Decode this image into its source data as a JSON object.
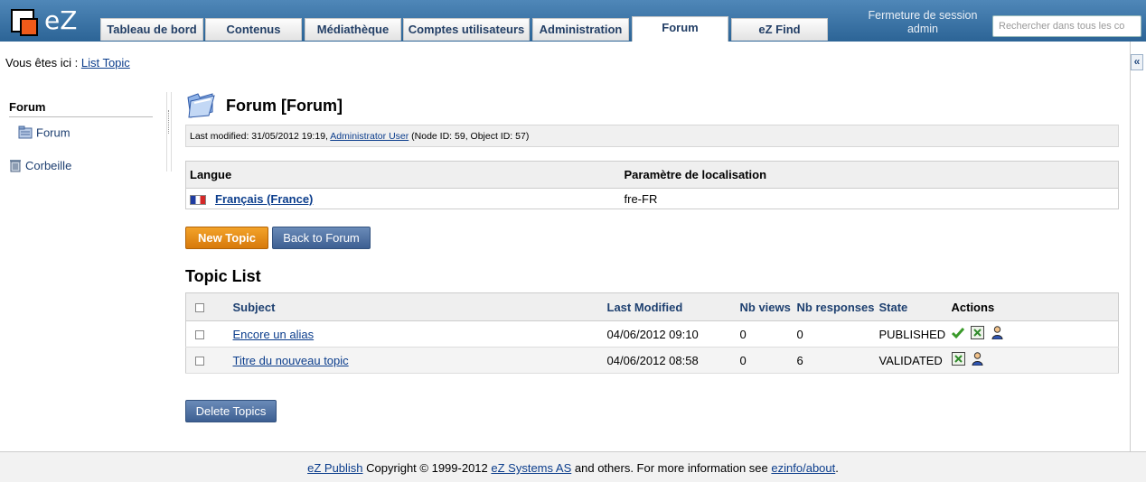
{
  "header": {
    "logo_text": "eZ",
    "tabs": [
      {
        "label": "Tableau de bord"
      },
      {
        "label": "Contenus"
      },
      {
        "label": "Médiathèque"
      },
      {
        "label": "Comptes utilisateurs"
      },
      {
        "label": "Administration"
      },
      {
        "label": "Forum"
      },
      {
        "label": "eZ Find"
      }
    ],
    "active_tab": "Forum",
    "logout_label": "Fermeture de session",
    "user": "admin",
    "search_placeholder": "Rechercher dans tous les co",
    "collapse_label": "«"
  },
  "breadcrumb": {
    "prefix": "Vous êtes ici :",
    "link": "List Topic"
  },
  "sidebar": {
    "title": "Forum",
    "items": [
      {
        "label": "Forum",
        "icon": "folder-icon"
      },
      {
        "label": "Corbeille",
        "icon": "trash-icon"
      }
    ]
  },
  "main": {
    "title": "Forum [Forum]",
    "meta_prefix": "Last modified: 31/05/2012 19:19,",
    "meta_author": "Administrator User",
    "meta_suffix": "(Node ID: 59, Object ID: 57)",
    "language_table": {
      "headers": [
        "Langue",
        "Paramètre de localisation"
      ],
      "rows": [
        {
          "language": "Français (France)",
          "locale": "fre-FR"
        }
      ]
    },
    "buttons": {
      "new_topic": "New Topic",
      "back_to_forum": "Back to Forum",
      "delete_topics": "Delete Topics"
    },
    "topic_list_title": "Topic List",
    "topic_table": {
      "headers": [
        "Subject",
        "Last Modified",
        "Nb views",
        "Nb responses",
        "State",
        "Actions"
      ],
      "rows": [
        {
          "subject": "Encore un alias",
          "last_modified": "04/06/2012 09:10",
          "views": "0",
          "responses": "0",
          "state": "PUBLISHED",
          "actions": [
            "validate-icon",
            "reject-icon",
            "user-icon"
          ]
        },
        {
          "subject": "Titre du nouveau topic",
          "last_modified": "04/06/2012 08:58",
          "views": "0",
          "responses": "6",
          "state": "VALIDATED",
          "actions": [
            "reject-icon",
            "user-icon"
          ]
        }
      ]
    }
  },
  "footer": {
    "link1": "eZ Publish",
    "text1": "Copyright © 1999-2012",
    "link2": "eZ Systems AS",
    "text2": "and others. For more information see",
    "link3": "ezinfo/about",
    "text3": "."
  }
}
